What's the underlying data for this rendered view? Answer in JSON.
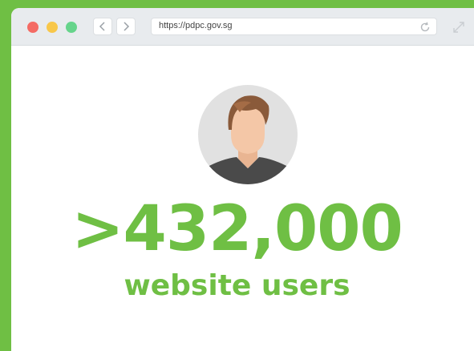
{
  "browser": {
    "url": "https://pdpc.gov.sg",
    "icons": {
      "back": "chevron-left-icon",
      "forward": "chevron-right-icon",
      "reload": "reload-icon",
      "expand": "expand-icon"
    },
    "traffic_light_colors": [
      "#f46b64",
      "#f8c74a",
      "#66d48b"
    ]
  },
  "stat": {
    "value": ">432,000",
    "label": "website users"
  },
  "colors": {
    "accent": "#6fbf44",
    "avatar_bg": "#e1e1e1",
    "hair": "#8a5a3a",
    "skin": "#f4c7a7",
    "shirt": "#4a4a4a"
  }
}
